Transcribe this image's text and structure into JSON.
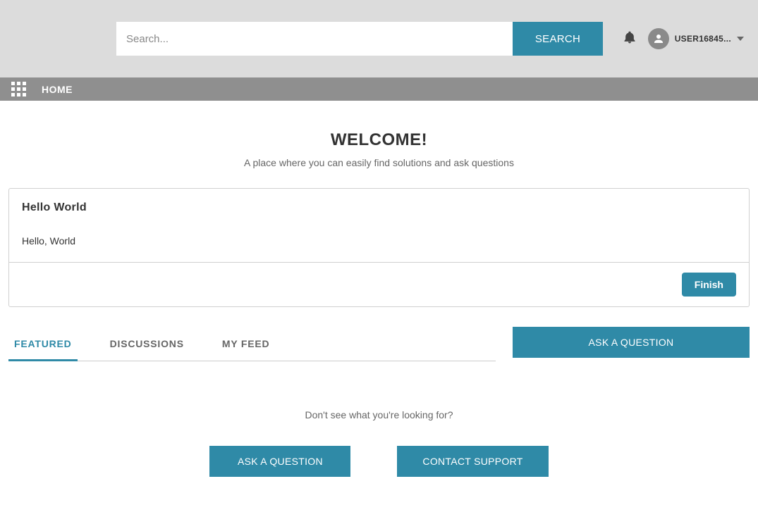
{
  "header": {
    "search_placeholder": "Search...",
    "search_button": "SEARCH",
    "username": "USER16845..."
  },
  "nav": {
    "home": "HOME"
  },
  "welcome": {
    "title": "WELCOME!",
    "subtitle": "A place where you can easily find solutions and ask questions"
  },
  "card": {
    "title": "Hello World",
    "body": "Hello, World",
    "finish": "Finish"
  },
  "tabs": {
    "items": [
      {
        "label": "FEATURED",
        "active": true
      },
      {
        "label": "DISCUSSIONS",
        "active": false
      },
      {
        "label": "MY FEED",
        "active": false
      }
    ]
  },
  "side": {
    "ask_button": "ASK A QUESTION"
  },
  "bottom": {
    "prompt": "Don't see what you're looking for?",
    "ask_button": "ASK A QUESTION",
    "contact_button": "CONTACT SUPPORT"
  }
}
